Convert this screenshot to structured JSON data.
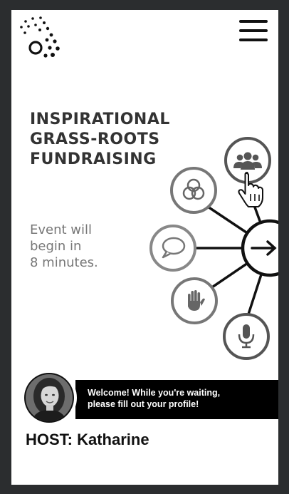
{
  "event": {
    "title_lines": [
      "INSPIRATIONAL",
      "GRASS-ROOTS",
      "FUNDRAISING"
    ],
    "status_lines": [
      "Event will",
      "begin in",
      "8 minutes."
    ]
  },
  "host": {
    "message_lines": [
      "Welcome! While you're waiting,",
      "please fill out your profile!"
    ],
    "label": "HOST: Katharine"
  },
  "icons": {
    "logo": "dotted-logo-icon",
    "menu": "hamburger-menu-icon",
    "group": "people-group-icon",
    "circles": "overlapping-circles-icon",
    "chat": "speech-bubble-icon",
    "hand": "raised-hand-icon",
    "mic": "microphone-icon",
    "arrow": "arrow-right-icon",
    "cursor": "pointer-hand-cursor-icon"
  },
  "colors": {
    "background": "#2b2d2f",
    "page": "#ffffff",
    "text_dark": "#333333",
    "text_muted": "#777777",
    "banner": "#000000"
  }
}
